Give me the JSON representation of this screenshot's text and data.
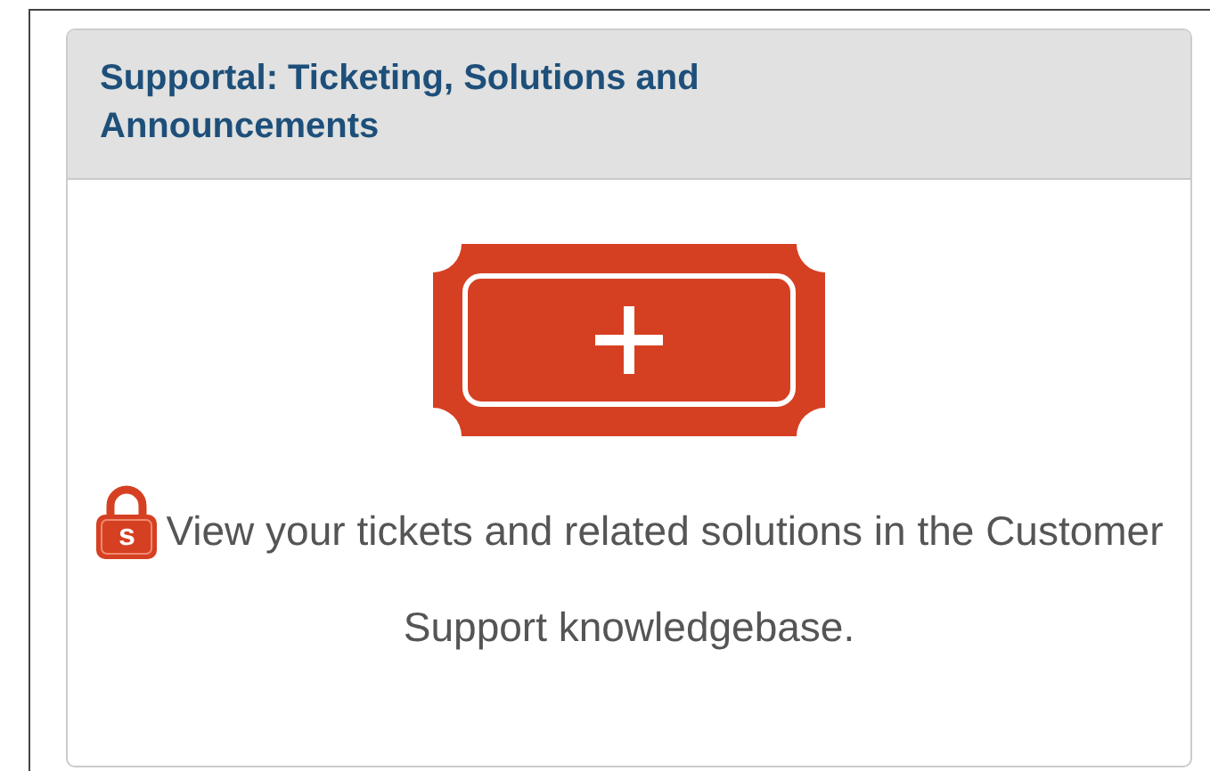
{
  "panel": {
    "title": "Supportal: Ticketing, Solutions and Announcements",
    "lock_letter": "s",
    "description": "View your tickets and related solutions in the Customer Support knowledgebase."
  }
}
